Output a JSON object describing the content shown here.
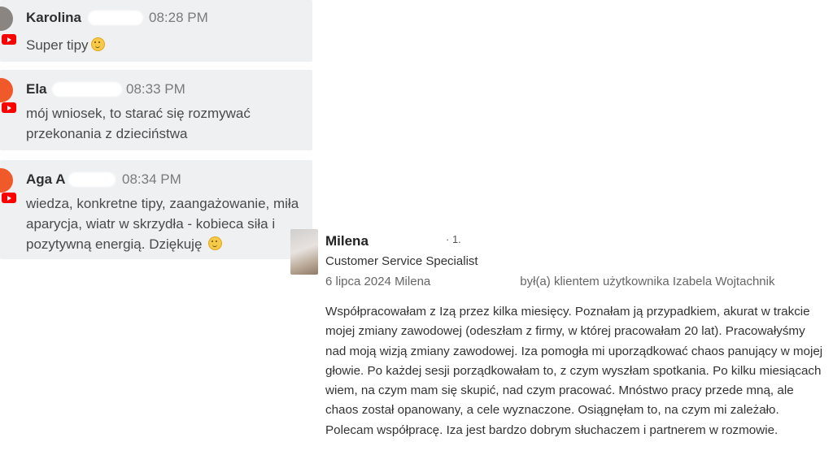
{
  "chat": [
    {
      "name": "Karolina",
      "time": "08:28 PM",
      "text": "Super tipy",
      "emoji": true,
      "avatar_color": "#8a8580"
    },
    {
      "name": "Ela",
      "time": "08:33 PM",
      "text": "mój wniosek, to starać się rozmywać przekonania z dzieciństwa",
      "emoji": false,
      "avatar_color": "#f05a2a"
    },
    {
      "name": "Aga A",
      "time": "08:34 PM",
      "text": "wiedza, konkretne tipy, zaangażowanie, miła aparycja, wiatr w skrzydła - kobieca siła i pozytywną energią. Dziękuję",
      "emoji": true,
      "avatar_color": "#f05a2a"
    }
  ],
  "badge_color": "#ff0000",
  "review": {
    "name": "Milena",
    "name_suffix": "· 1.",
    "role": "Customer Service Specialist",
    "meta_prefix": "6 lipca 2024 Milena",
    "meta_suffix": "był(a) klientem użytkownika Izabela Wojtachnik",
    "body": "Współpracowałam z Izą przez kilka miesięcy. Poznałam ją przypadkiem, akurat w trakcie mojej zmiany zawodowej (odeszłam z firmy, w której pracowałam 20 lat). Pracowałyśmy nad moją wizją zmiany zawodowej. Iza pomogła mi uporządkować chaos panujący w mojej głowie. Po każdej sesji porządkowałam to, z czym wyszłam spotkania. Po kilku miesiącach wiem, na czym mam się skupić, nad czym pracować. Mnóstwo pracy przede mną, ale chaos został opanowany, a cele wyznaczone. Osiągnęłam to, na czym mi zależało. Polecam współpracę. Iza jest bardzo dobrym słuchaczem i partnerem w rozmowie."
  }
}
